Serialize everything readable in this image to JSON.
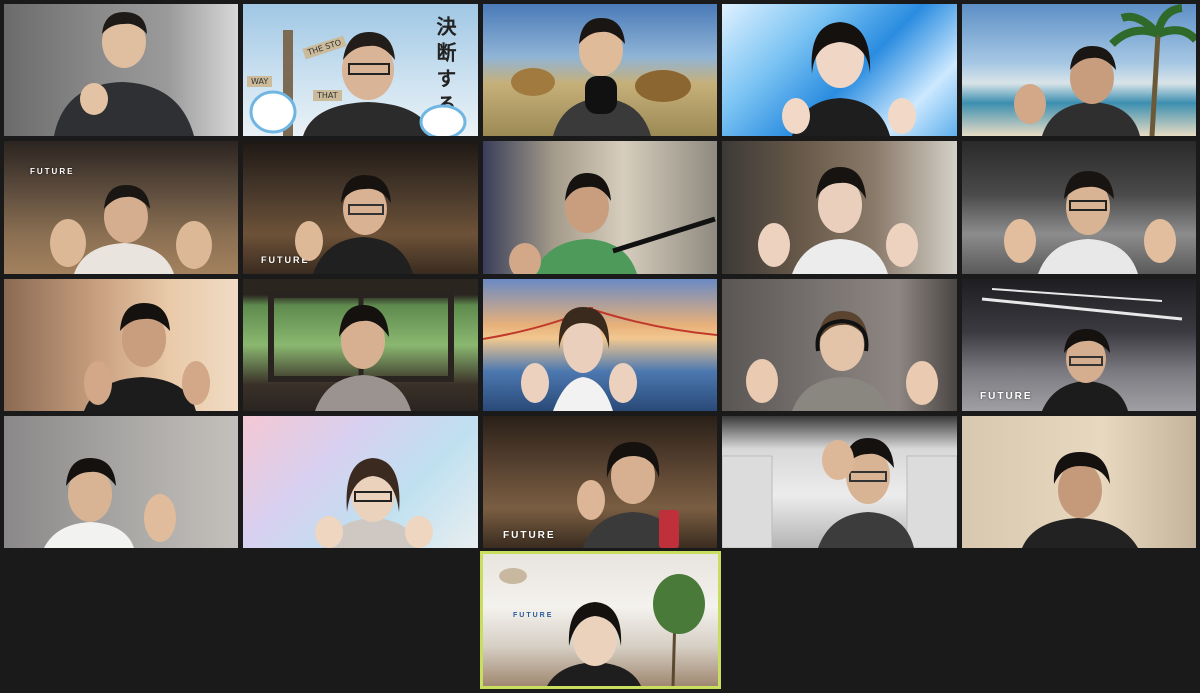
{
  "meeting": {
    "view": "gallery",
    "participant_count": 21
  },
  "labels": {
    "brand_text": "FUTURE",
    "decision_text": "決断する",
    "sign_top": "THE STO",
    "sign_mid": "WAY",
    "sign_right": "THAT"
  },
  "colors": {
    "background": "#1a1a1a",
    "active_speaker_border": "#c9dd5e"
  }
}
